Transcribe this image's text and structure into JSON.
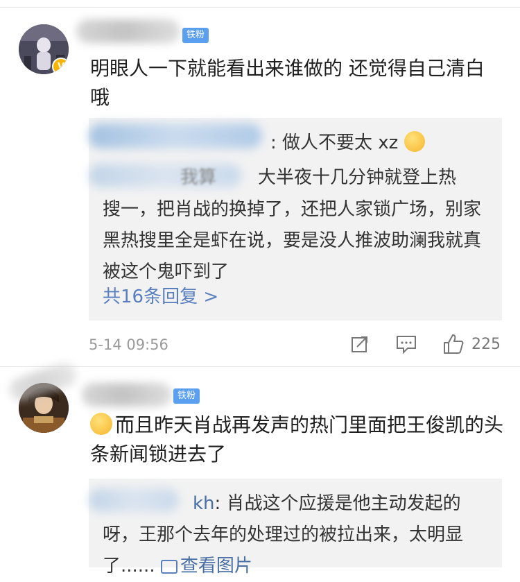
{
  "comment1": {
    "fan_badge": "铁粉",
    "text": "明眼人一下就能看出来谁做的   还觉得自己清白哦",
    "reply_line1_suffix": ": 做人不要太 xz",
    "reply_line2": "大半夜十几分钟就登上热",
    "reply_lines_rest": "搜一，把肖战的换掉了，还把人家锁广场，别家黑热搜里全是虾在说，要是没人推波助澜我就真被这个鬼吓到了",
    "more_replies": "共16条回复 >",
    "time": "5-14 09:56",
    "likes": "225",
    "reply_blur_fragment": "我算"
  },
  "comment2": {
    "fan_badge": "铁粉",
    "text": "而且昨天肖战再发声的热门里面把王俊凯的头条新闻锁进去了",
    "reply_author_suffix": "kh",
    "reply_text": ": 肖战这个应援是他主动发起的呀，王那个去年的处理过的被拉出来，太明显了......",
    "view_images": "查看图片"
  }
}
